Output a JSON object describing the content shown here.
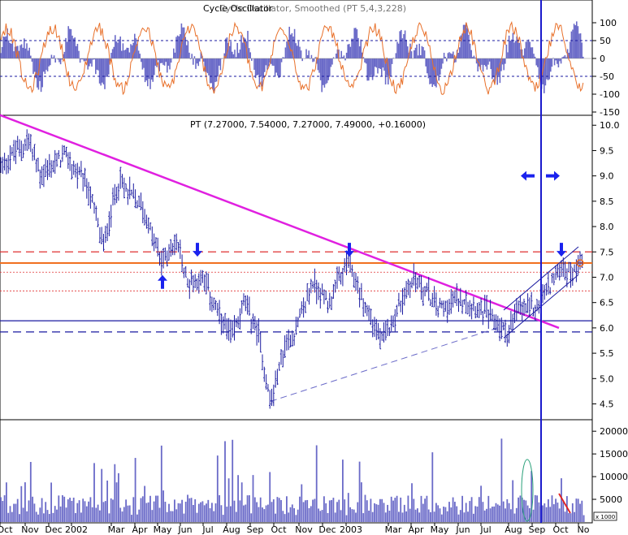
{
  "colors": {
    "background": "#ffffff",
    "price_bar": "#1c1ca0",
    "histogram": "#6a6ac8",
    "oscillator_line": "#e8702a",
    "volume": "#6a6ac8",
    "trendline": "#e020e0",
    "support": "#1a1aa0",
    "resistance_dash": "#e03030",
    "resistance_solid": "#f07020",
    "cursor": "#1a1acc",
    "arrow": "#1a22ee",
    "grid": "#c8c8c8",
    "axis": "#000000"
  },
  "chart_data": [
    {
      "panel": "oscillator",
      "type": "bar",
      "title": "Cycle Oscillator",
      "title_overlay": "Cycle Oscillator, Smoothed (PT 5,4,3,228)",
      "ylim": [
        -150,
        150
      ],
      "y_ticks": [
        "100",
        "50",
        "0",
        "-50",
        "-100",
        "-150"
      ],
      "reference_lines": [
        50,
        -50
      ],
      "series": [
        {
          "kind": "histogram"
        },
        {
          "kind": "line"
        }
      ]
    },
    {
      "panel": "price",
      "type": "ohlc",
      "title": "PT (7.27000, 7.54000, 7.27000, 7.49000, +0.16000)",
      "ylim": [
        4.3,
        10.1
      ],
      "y_ticks": [
        "10.0",
        "9.5",
        "9.0",
        "8.5",
        "8.0",
        "7.5",
        "7.0",
        "6.5",
        "6.0",
        "5.5",
        "5.0",
        "4.5"
      ],
      "x_ticks": [
        "Oct",
        "Nov",
        "Dec",
        "2002",
        "Mar",
        "Apr",
        "May",
        "Jun",
        "Jul",
        "Aug",
        "Sep",
        "Oct",
        "Nov",
        "Dec",
        "2003",
        "Mar",
        "Apr",
        "May",
        "Jun",
        "Jul",
        "Aug",
        "Sep",
        "Oct",
        "No"
      ],
      "anchors": [
        {
          "x": 0,
          "y": 9.2
        },
        {
          "x": 35,
          "y": 9.7
        },
        {
          "x": 50,
          "y": 9.0
        },
        {
          "x": 80,
          "y": 9.4
        },
        {
          "x": 110,
          "y": 8.7
        },
        {
          "x": 127,
          "y": 7.6
        },
        {
          "x": 145,
          "y": 8.9
        },
        {
          "x": 175,
          "y": 8.4
        },
        {
          "x": 198,
          "y": 7.3
        },
        {
          "x": 218,
          "y": 7.7
        },
        {
          "x": 230,
          "y": 6.9
        },
        {
          "x": 250,
          "y": 7.0
        },
        {
          "x": 270,
          "y": 6.2
        },
        {
          "x": 285,
          "y": 5.8
        },
        {
          "x": 300,
          "y": 6.5
        },
        {
          "x": 318,
          "y": 5.9
        },
        {
          "x": 333,
          "y": 4.5
        },
        {
          "x": 350,
          "y": 5.6
        },
        {
          "x": 365,
          "y": 6.0
        },
        {
          "x": 385,
          "y": 6.9
        },
        {
          "x": 405,
          "y": 6.5
        },
        {
          "x": 428,
          "y": 7.3
        },
        {
          "x": 445,
          "y": 6.6
        },
        {
          "x": 470,
          "y": 5.7
        },
        {
          "x": 490,
          "y": 6.4
        },
        {
          "x": 510,
          "y": 7.0
        },
        {
          "x": 540,
          "y": 6.4
        },
        {
          "x": 570,
          "y": 6.6
        },
        {
          "x": 600,
          "y": 6.3
        },
        {
          "x": 624,
          "y": 5.9
        },
        {
          "x": 640,
          "y": 6.4
        },
        {
          "x": 660,
          "y": 6.4
        },
        {
          "x": 690,
          "y": 7.2
        },
        {
          "x": 705,
          "y": 7.05
        },
        {
          "x": 718,
          "y": 7.49
        }
      ],
      "levels": {
        "resistance_dash": 7.5,
        "resistance_solid": 7.28,
        "minor_dotted_top": 7.1,
        "minor_dotted_bottom": 6.73,
        "support_solid": 6.14,
        "support_dash": 5.92
      },
      "trendlines": [
        {
          "kind": "downtrend",
          "from": [
            0,
            10.2
          ],
          "to": [
            688,
            6.0
          ]
        },
        {
          "kind": "uptrend_dashed",
          "from": [
            333,
            4.55
          ],
          "to": [
            622,
            6.05
          ]
        },
        {
          "kind": "channel_lower",
          "from": [
            620,
            5.8
          ],
          "to": [
            712,
            7.05
          ]
        },
        {
          "kind": "channel_upper",
          "from": [
            620,
            6.35
          ],
          "to": [
            712,
            7.6
          ]
        }
      ],
      "arrows": [
        {
          "dir": "up",
          "x": 200,
          "y": 6.9
        },
        {
          "dir": "down",
          "x": 243,
          "y": 7.55
        },
        {
          "dir": "down",
          "x": 430,
          "y": 7.55
        },
        {
          "dir": "down",
          "x": 691,
          "y": 7.55
        },
        {
          "dir": "left",
          "x": 650,
          "y": 9.0
        },
        {
          "dir": "right",
          "x": 680,
          "y": 9.0
        }
      ],
      "cursor_x": 666
    },
    {
      "panel": "volume",
      "type": "bar",
      "ylim": [
        0,
        22000
      ],
      "y_ticks": [
        "20000",
        "15000",
        "10000",
        "5000"
      ],
      "unit_label": "x 1000"
    }
  ]
}
